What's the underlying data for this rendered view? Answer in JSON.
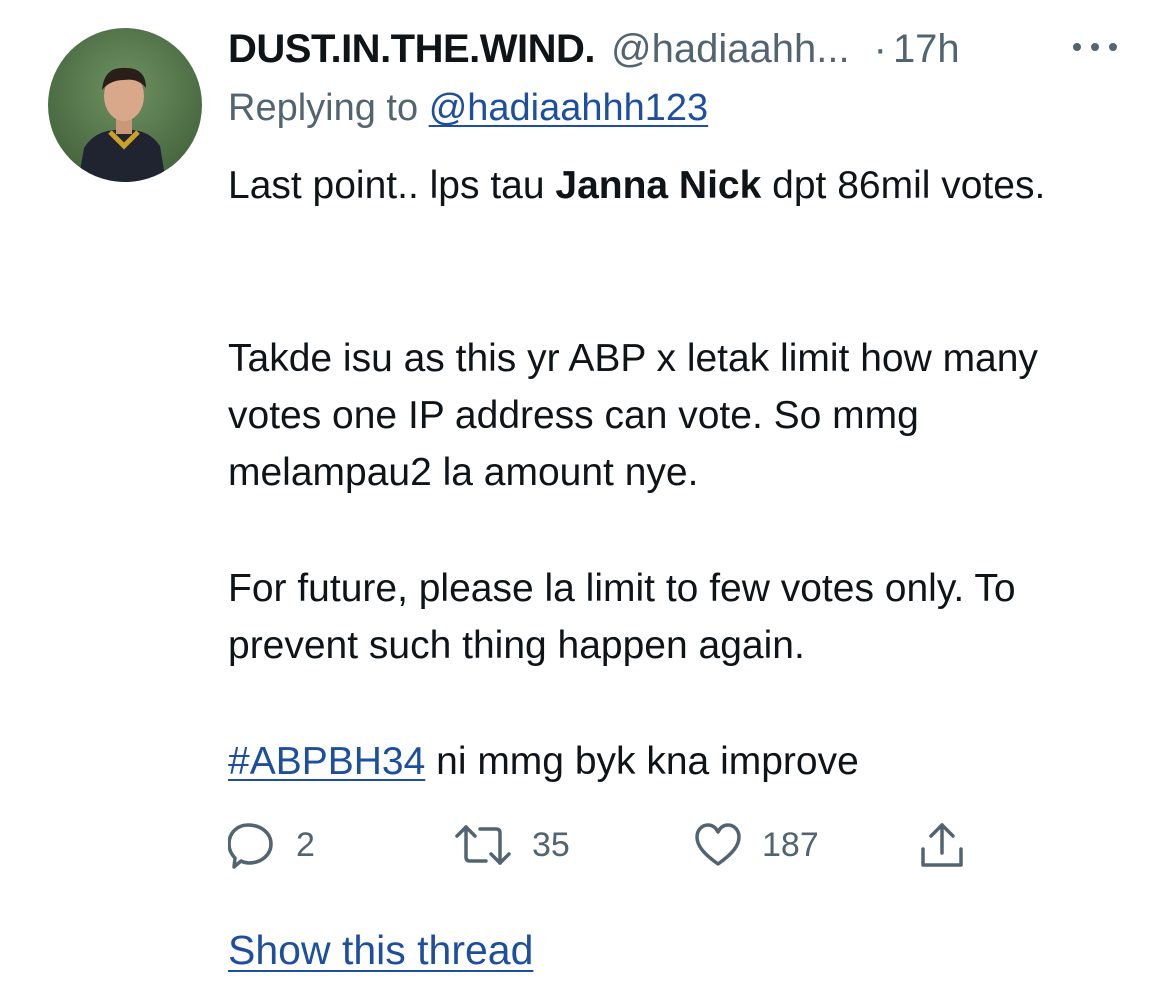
{
  "tweet": {
    "display_name": "DUST.IN.THE.WIND.",
    "handle": "@hadiaahh...",
    "separator": "·",
    "timestamp": "17h",
    "replying_prefix": "Replying to",
    "reply_to_handle": "@hadiaahhh123",
    "p1_before_bold": "Last point.. lps tau ",
    "p1_bold": "Janna Nick",
    "p1_after_bold": " dpt 86mil votes.",
    "p2": "Takde isu as this yr ABP x letak limit how many votes one IP address can vote. So mmg melampau2 la amount nye.",
    "p3": "For future, please la limit to few votes only. To prevent such thing happen again.",
    "hashtag": "#ABPBH34",
    "p4_after_hashtag": " ni mmg byk kna improve"
  },
  "actions": {
    "reply": {
      "icon": "reply-icon",
      "count": "2"
    },
    "retweet": {
      "icon": "retweet-icon",
      "count": "35"
    },
    "like": {
      "icon": "heart-icon",
      "count": "187"
    },
    "share": {
      "icon": "share-icon"
    }
  },
  "show_thread": "Show this thread",
  "colors": {
    "text": "#0f1419",
    "secondary": "#536471",
    "link": "#1d4f9e"
  }
}
